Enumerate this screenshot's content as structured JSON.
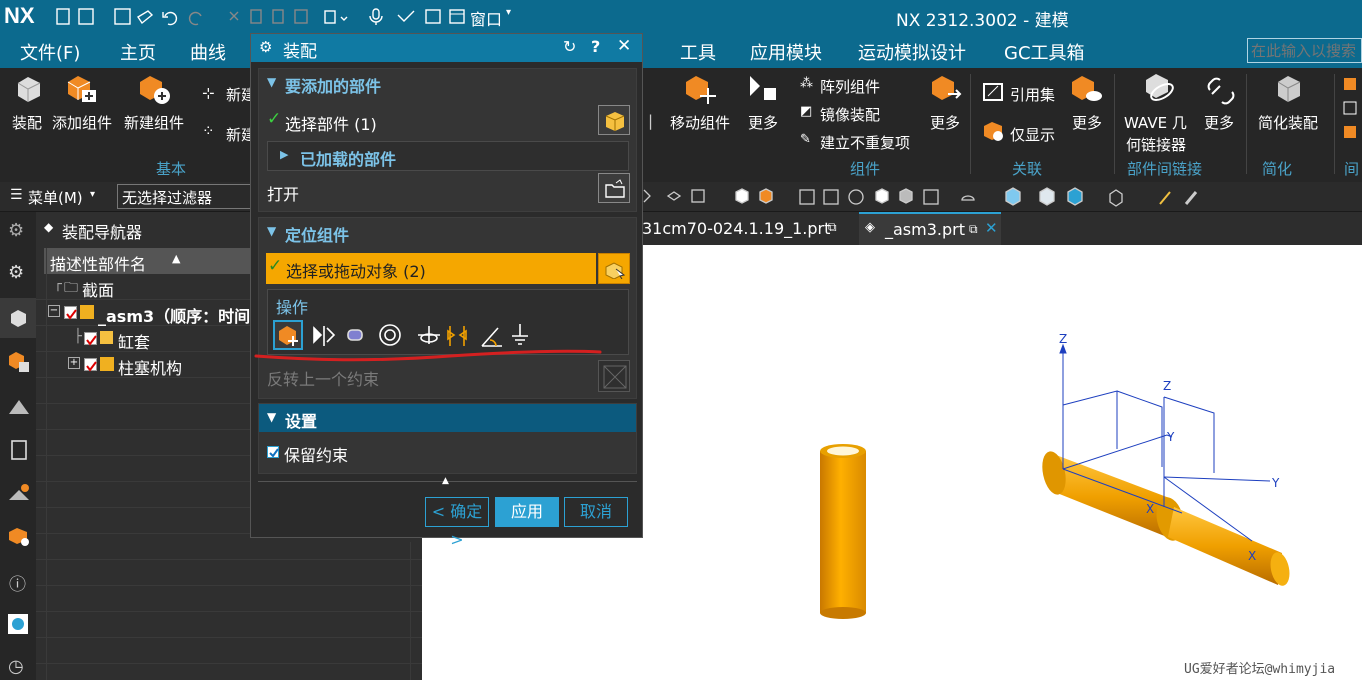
{
  "app": {
    "logo": "NX",
    "title": "NX 2312.3002 - 建模",
    "window_menu": "窗口"
  },
  "menu": {
    "file": "文件(F)",
    "items": [
      "主页",
      "曲线",
      "工具",
      "应用模块",
      "运动模拟设计",
      "GC工具箱"
    ],
    "search_placeholder": "在此输入以搜索"
  },
  "ribbon": {
    "assemble": "装配",
    "add_component": "添加组件",
    "new_component": "新建组件",
    "new_a": "新建",
    "new_b": "新建",
    "group_basic": "基本",
    "move_component": "移动组件",
    "more1": "更多",
    "array_component": "阵列组件",
    "mirror_assembly": "镜像装配",
    "create_unique": "建立不重复项",
    "group_component": "组件",
    "more2": "更多",
    "reference_set": "引用集",
    "show_only": "仅显示",
    "more3": "更多",
    "group_relation": "关联",
    "wave_linker_1": "WAVE 几",
    "wave_linker_2": "何链接器",
    "more4": "更多",
    "group_interpart": "部件间链接",
    "simplify": "简化装配",
    "group_simplify": "简化",
    "group_extra": "间"
  },
  "toolbar2": {
    "menu": "菜单(M)",
    "filter": "无选择过滤器"
  },
  "navigator": {
    "title": "装配导航器",
    "column": "描述性部件名",
    "rows": [
      {
        "label": "截面"
      },
      {
        "label": "_asm3（顺序：时间"
      },
      {
        "label": "缸套"
      },
      {
        "label": "柱塞机构"
      }
    ]
  },
  "tabs": {
    "tab1": "31cm70-024.1.19_1.prt",
    "tab2": "_asm3.prt"
  },
  "dialog": {
    "title": "装配",
    "sec_add": "要添加的部件",
    "select_part": "选择部件 (1)",
    "loaded_parts": "已加载的部件",
    "open": "打开",
    "sec_position": "定位组件",
    "select_drag": "选择或拖动对象 (2)",
    "operations": "操作",
    "reverse_constraint": "反转上一个约束",
    "sec_settings": "设置",
    "keep_constraints": "保留约束",
    "ok": "< 确定 >",
    "apply": "应用",
    "cancel": "取消"
  },
  "viewport": {
    "watermark": "UG爱好者论坛@whimyjia",
    "axis_z": "Z",
    "axis_y": "Y",
    "axis_x": "X"
  },
  "colors": {
    "accent": "#107aa3",
    "highlight": "#f5a700",
    "part": "#f0a300",
    "annotation": "#d42020"
  }
}
